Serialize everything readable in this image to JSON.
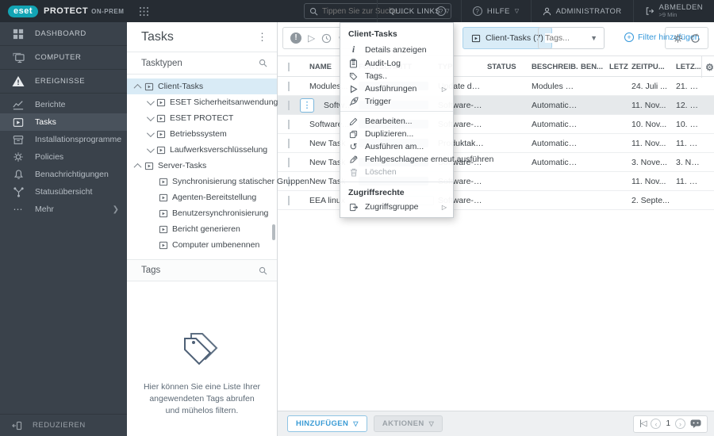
{
  "topbar": {
    "brand": "eset",
    "product": "PROTECT",
    "edition": "ON-PREM",
    "search_placeholder": "Tippen Sie zur Suche...",
    "quick_links": "QUICK LINKS",
    "help": "HILFE",
    "user": "ADMINISTRATOR",
    "logout": "ABMELDEN",
    "logout_sub": ">9 Min"
  },
  "sidebar": {
    "items": [
      {
        "label": "DASHBOARD"
      },
      {
        "label": "COMPUTER"
      },
      {
        "label": "EREIGNISSE"
      },
      {
        "label": "Berichte"
      },
      {
        "label": "Tasks"
      },
      {
        "label": "Installationsprogramme"
      },
      {
        "label": "Policies"
      },
      {
        "label": "Benachrichtigungen"
      },
      {
        "label": "Statusübersicht"
      },
      {
        "label": "Mehr"
      }
    ],
    "collapse": "REDUZIEREN"
  },
  "panel": {
    "title": "Tasks",
    "tasktypen_label": "Tasktypen",
    "tags_label": "Tags",
    "tree": [
      {
        "label": "Client-Tasks"
      },
      {
        "label": "ESET Sicherheitsanwendung"
      },
      {
        "label": "ESET PROTECT"
      },
      {
        "label": "Betriebssystem"
      },
      {
        "label": "Laufwerksverschlüsselung"
      },
      {
        "label": "Server-Tasks"
      },
      {
        "label": "Synchronisierung statischer Gruppen"
      },
      {
        "label": "Agenten-Bereitstellung"
      },
      {
        "label": "Benutzersynchronisierung"
      },
      {
        "label": "Bericht generieren"
      },
      {
        "label": "Computer umbenennen"
      }
    ],
    "tags_empty": "Hier können Sie eine Liste Ihrer angewendeten Tags abrufen und mühelos filtern."
  },
  "toolbar": {
    "chip": "Client-Tasks (7)",
    "tags_placeholder": "Tags...",
    "filter": "Filter hinzufügen"
  },
  "table": {
    "headers": {
      "name": "NAME",
      "progress": "FORTSCHRITT",
      "typ": "TYP",
      "status": "STATUS",
      "beschreibung": "BESCHREIB...",
      "ben": "BEN...",
      "letz1": "LETZ...",
      "zeitpunkt": "ZEITPU...",
      "letz2": "LETZ..."
    },
    "rows": [
      {
        "name": "Modules...",
        "typ": "Update der Module",
        "beschreibung": "Modules of t...",
        "zeitpunkt": "24. Juli ...",
        "letzte": "21. N..."
      },
      {
        "name": "Softwar...",
        "typ": "Software-Deinstallation",
        "beschreibung": "Automaticall...",
        "zeitpunkt": "11. Nov...",
        "letzte": "12. N..."
      },
      {
        "name": "Software...",
        "typ": "Software-Installation",
        "beschreibung": "Automaticall...",
        "zeitpunkt": "10. Nov...",
        "letzte": "10. N..."
      },
      {
        "name": "New Task",
        "typ": "Produktaktivierung",
        "beschreibung": "Automaticall...",
        "zeitpunkt": "11. Nov...",
        "letzte": "11. N..."
      },
      {
        "name": "New Task",
        "typ": "Software-Installation",
        "beschreibung": "Automaticall...",
        "zeitpunkt": "3. Nove...",
        "letzte": "3. Nov..."
      },
      {
        "name": "New Task",
        "typ": "Software-Installation",
        "beschreibung": "",
        "zeitpunkt": "11. Nov...",
        "letzte": "11. N..."
      },
      {
        "name": "EEA linux",
        "typ": "Software-Inst...",
        "beschreibung": "",
        "zeitpunkt": "2. Septe...",
        "letzte": ""
      }
    ]
  },
  "menu": {
    "header": "Client-Tasks",
    "items": [
      {
        "label": "Details anzeigen"
      },
      {
        "label": "Audit-Log"
      },
      {
        "label": "Tags.."
      },
      {
        "label": "Ausführungen"
      },
      {
        "label": "Trigger"
      },
      {
        "label": "Bearbeiten..."
      },
      {
        "label": "Duplizieren..."
      },
      {
        "label": "Ausführen am..."
      },
      {
        "label": "Fehlgeschlagene erneut ausführen"
      },
      {
        "label": "Löschen"
      }
    ],
    "section2": "Zugriffsrechte",
    "access_item": "Zugriffsgruppe"
  },
  "footer": {
    "add": "HINZUFÜGEN",
    "actions": "AKTIONEN",
    "page": "1"
  }
}
